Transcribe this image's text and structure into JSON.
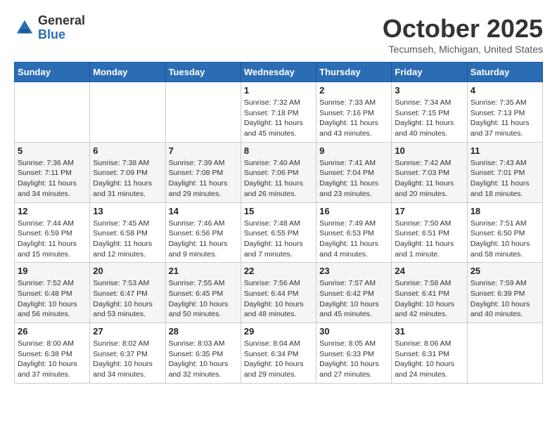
{
  "header": {
    "logo_general": "General",
    "logo_blue": "Blue",
    "month": "October 2025",
    "location": "Tecumseh, Michigan, United States"
  },
  "weekdays": [
    "Sunday",
    "Monday",
    "Tuesday",
    "Wednesday",
    "Thursday",
    "Friday",
    "Saturday"
  ],
  "weeks": [
    [
      null,
      null,
      null,
      {
        "day": "1",
        "sunrise": "7:32 AM",
        "sunset": "7:18 PM",
        "daylight": "11 hours and 45 minutes."
      },
      {
        "day": "2",
        "sunrise": "7:33 AM",
        "sunset": "7:16 PM",
        "daylight": "11 hours and 43 minutes."
      },
      {
        "day": "3",
        "sunrise": "7:34 AM",
        "sunset": "7:15 PM",
        "daylight": "11 hours and 40 minutes."
      },
      {
        "day": "4",
        "sunrise": "7:35 AM",
        "sunset": "7:13 PM",
        "daylight": "11 hours and 37 minutes."
      }
    ],
    [
      {
        "day": "5",
        "sunrise": "7:36 AM",
        "sunset": "7:11 PM",
        "daylight": "11 hours and 34 minutes."
      },
      {
        "day": "6",
        "sunrise": "7:38 AM",
        "sunset": "7:09 PM",
        "daylight": "11 hours and 31 minutes."
      },
      {
        "day": "7",
        "sunrise": "7:39 AM",
        "sunset": "7:08 PM",
        "daylight": "11 hours and 29 minutes."
      },
      {
        "day": "8",
        "sunrise": "7:40 AM",
        "sunset": "7:06 PM",
        "daylight": "11 hours and 26 minutes."
      },
      {
        "day": "9",
        "sunrise": "7:41 AM",
        "sunset": "7:04 PM",
        "daylight": "11 hours and 23 minutes."
      },
      {
        "day": "10",
        "sunrise": "7:42 AM",
        "sunset": "7:03 PM",
        "daylight": "11 hours and 20 minutes."
      },
      {
        "day": "11",
        "sunrise": "7:43 AM",
        "sunset": "7:01 PM",
        "daylight": "11 hours and 18 minutes."
      }
    ],
    [
      {
        "day": "12",
        "sunrise": "7:44 AM",
        "sunset": "6:59 PM",
        "daylight": "11 hours and 15 minutes."
      },
      {
        "day": "13",
        "sunrise": "7:45 AM",
        "sunset": "6:58 PM",
        "daylight": "11 hours and 12 minutes."
      },
      {
        "day": "14",
        "sunrise": "7:46 AM",
        "sunset": "6:56 PM",
        "daylight": "11 hours and 9 minutes."
      },
      {
        "day": "15",
        "sunrise": "7:48 AM",
        "sunset": "6:55 PM",
        "daylight": "11 hours and 7 minutes."
      },
      {
        "day": "16",
        "sunrise": "7:49 AM",
        "sunset": "6:53 PM",
        "daylight": "11 hours and 4 minutes."
      },
      {
        "day": "17",
        "sunrise": "7:50 AM",
        "sunset": "6:51 PM",
        "daylight": "11 hours and 1 minute."
      },
      {
        "day": "18",
        "sunrise": "7:51 AM",
        "sunset": "6:50 PM",
        "daylight": "10 hours and 58 minutes."
      }
    ],
    [
      {
        "day": "19",
        "sunrise": "7:52 AM",
        "sunset": "6:48 PM",
        "daylight": "10 hours and 56 minutes."
      },
      {
        "day": "20",
        "sunrise": "7:53 AM",
        "sunset": "6:47 PM",
        "daylight": "10 hours and 53 minutes."
      },
      {
        "day": "21",
        "sunrise": "7:55 AM",
        "sunset": "6:45 PM",
        "daylight": "10 hours and 50 minutes."
      },
      {
        "day": "22",
        "sunrise": "7:56 AM",
        "sunset": "6:44 PM",
        "daylight": "10 hours and 48 minutes."
      },
      {
        "day": "23",
        "sunrise": "7:57 AM",
        "sunset": "6:42 PM",
        "daylight": "10 hours and 45 minutes."
      },
      {
        "day": "24",
        "sunrise": "7:58 AM",
        "sunset": "6:41 PM",
        "daylight": "10 hours and 42 minutes."
      },
      {
        "day": "25",
        "sunrise": "7:59 AM",
        "sunset": "6:39 PM",
        "daylight": "10 hours and 40 minutes."
      }
    ],
    [
      {
        "day": "26",
        "sunrise": "8:00 AM",
        "sunset": "6:38 PM",
        "daylight": "10 hours and 37 minutes."
      },
      {
        "day": "27",
        "sunrise": "8:02 AM",
        "sunset": "6:37 PM",
        "daylight": "10 hours and 34 minutes."
      },
      {
        "day": "28",
        "sunrise": "8:03 AM",
        "sunset": "6:35 PM",
        "daylight": "10 hours and 32 minutes."
      },
      {
        "day": "29",
        "sunrise": "8:04 AM",
        "sunset": "6:34 PM",
        "daylight": "10 hours and 29 minutes."
      },
      {
        "day": "30",
        "sunrise": "8:05 AM",
        "sunset": "6:33 PM",
        "daylight": "10 hours and 27 minutes."
      },
      {
        "day": "31",
        "sunrise": "8:06 AM",
        "sunset": "6:31 PM",
        "daylight": "10 hours and 24 minutes."
      },
      null
    ]
  ],
  "labels": {
    "sunrise_prefix": "Sunrise: ",
    "sunset_prefix": "Sunset: ",
    "daylight_prefix": "Daylight: "
  }
}
